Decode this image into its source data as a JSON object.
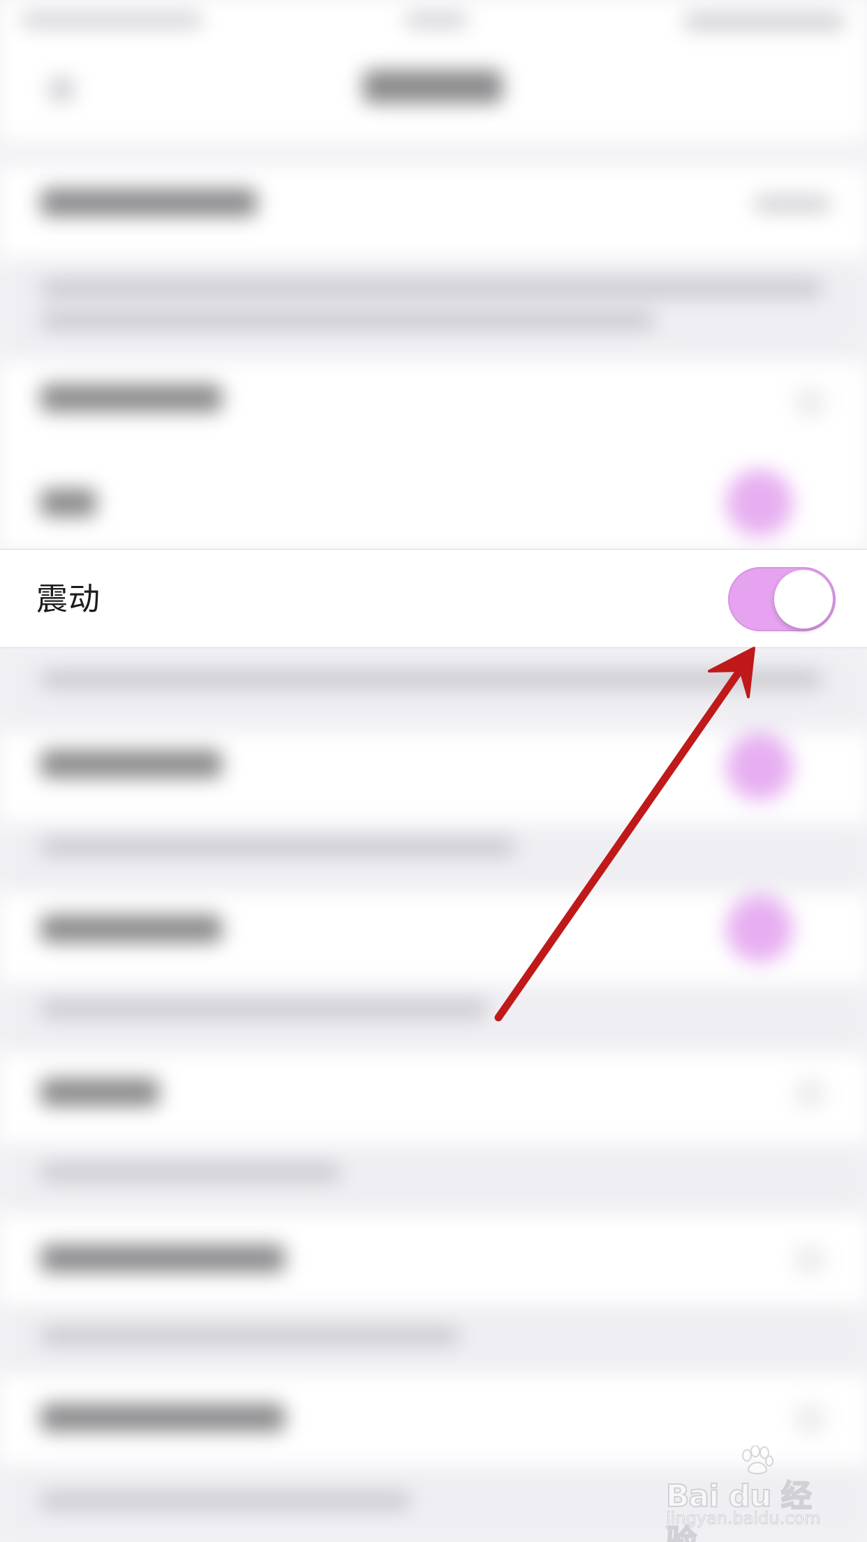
{
  "settings_row": {
    "label": "震动",
    "toggle_on": true
  },
  "watermark": {
    "brand": "Bai du 经验",
    "url": "jingyan.baidu.com"
  },
  "colors": {
    "toggle_on": "#e6a3ef",
    "arrow": "#c0191a",
    "page_background": "#f3f3f6"
  },
  "icons": {
    "annotation": "red-arrow-icon",
    "watermark": "baidu-paw-icon"
  }
}
